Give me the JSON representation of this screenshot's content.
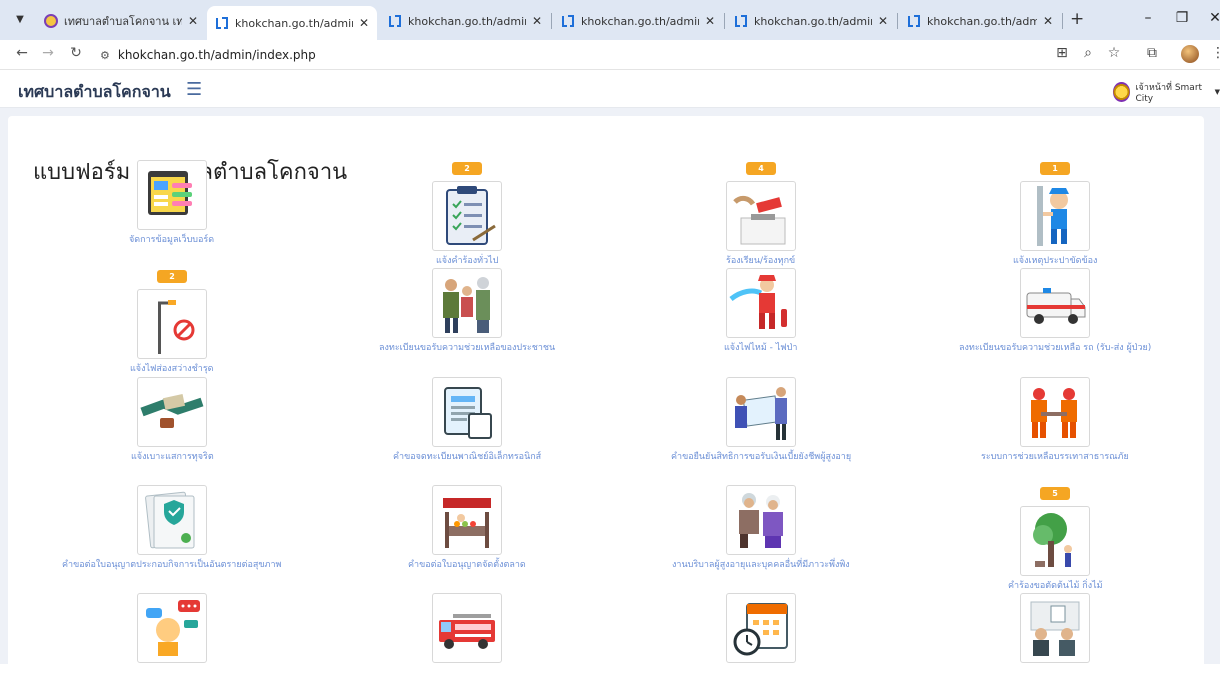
{
  "browser": {
    "tabs": [
      {
        "title": "เทศบาลตำบลโคกจาน เทศบาลตำบ",
        "favicon": "government-seal-icon",
        "active": false
      },
      {
        "title": "khokchan.go.th/admin/index",
        "favicon": "admin-logo-icon",
        "active": true
      },
      {
        "title": "khokchan.go.th/admin/index",
        "favicon": "admin-logo-icon",
        "active": false
      },
      {
        "title": "khokchan.go.th/admin/agen",
        "favicon": "admin-logo-icon",
        "active": false
      },
      {
        "title": "khokchan.go.th/admin/agen",
        "favicon": "admin-logo-icon",
        "active": false
      },
      {
        "title": "khokchan.go.th/admin/agen",
        "favicon": "admin-logo-icon",
        "active": false
      }
    ],
    "address": "khokchan.go.th/admin/index.php"
  },
  "site": {
    "brand": "เทศบาลตำบลโคกจาน",
    "user_label": "เจ้าหน้าที่ Smart City"
  },
  "page": {
    "title": "แบบฟอร์ม เทศบาลตำบลโคกจาน"
  },
  "cards": [
    {
      "label": "จัดการข้อมูลเว็บบอร์ด",
      "badge": "",
      "icon": "webboard-icon"
    },
    {
      "label": "แจ้งคำร้องทั่วไป",
      "badge": "2",
      "icon": "clipboard-form-icon"
    },
    {
      "label": "ร้องเรียน/ร้องทุกข์",
      "badge": "4",
      "icon": "complaint-box-icon"
    },
    {
      "label": "แจ้งเหตุประปาขัดข้อง",
      "badge": "1",
      "icon": "plumber-icon"
    },
    {
      "label": "แจ้งไฟส่องสว่างชำรุด",
      "badge": "2",
      "icon": "broken-streetlight-icon"
    },
    {
      "label": "ลงทะเบียนขอรับความช่วยเหลือของประชาชน",
      "badge": "",
      "icon": "family-icon"
    },
    {
      "label": "แจ้งไฟไหม้ - ไฟป่า",
      "badge": "",
      "icon": "firefighter-icon"
    },
    {
      "label": "ลงทะเบียนขอรับความช่วยเหลือ รถ (รับ-ส่ง ผู้ป่วย)",
      "badge": "",
      "icon": "ambulance-icon"
    },
    {
      "label": "แจ้งเบาะแสการทุจริต",
      "badge": "",
      "icon": "bribery-handshake-icon"
    },
    {
      "label": "คำขอจดทะเบียนพาณิชย์อิเล็กทรอนิกส์",
      "badge": "",
      "icon": "e-document-icon"
    },
    {
      "label": "คำขอยืนยันสิทธิการขอรับเงินเบี้ยยังชีพผู้สูงอายุ",
      "badge": "",
      "icon": "elderly-allowance-icon"
    },
    {
      "label": "ระบบการช่วยเหลือบรรเทาสาธารณภัย",
      "badge": "",
      "icon": "rescue-team-icon"
    },
    {
      "label": "คำขอต่อใบอนุญาตประกอบกิจการเป็นอันตรายต่อสุขภาพ",
      "badge": "",
      "icon": "health-certificate-icon"
    },
    {
      "label": "คำขอต่อใบอนุญาตจัดตั้งตลาด",
      "badge": "",
      "icon": "market-stall-icon"
    },
    {
      "label": "งานบริบาลผู้สูงอายุและบุคคลอื่นที่มีภาวะพึ่งพิง",
      "badge": "",
      "icon": "elderly-care-icon"
    },
    {
      "label": "คำร้องขอตัดต้นไม้ กิ่งไม้",
      "badge": "5",
      "icon": "tree-cutting-icon"
    },
    {
      "label": "",
      "badge": "",
      "icon": "chat-feedback-icon"
    },
    {
      "label": "",
      "badge": "",
      "icon": "fire-truck-icon"
    },
    {
      "label": "",
      "badge": "",
      "icon": "calendar-timer-icon"
    },
    {
      "label": "",
      "badge": "",
      "icon": "meeting-people-icon"
    }
  ]
}
